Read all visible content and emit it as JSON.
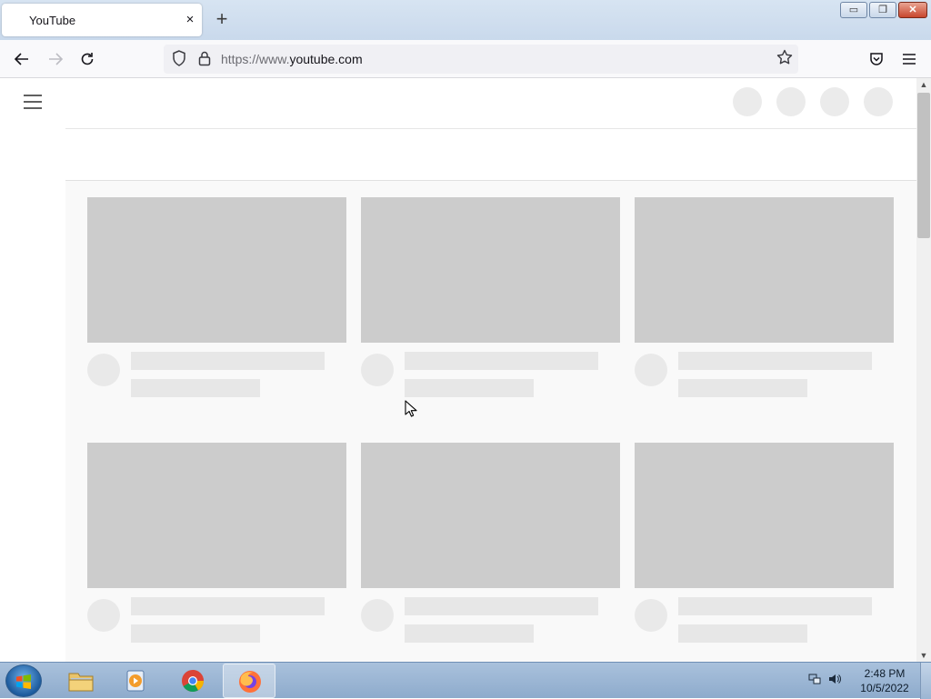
{
  "browser": {
    "tab_title": "YouTube",
    "tab_close": "×",
    "new_tab": "+",
    "url_prefix": "https://www.",
    "url_domain": "youtube.com",
    "window_controls": {
      "minimize": "▭",
      "restore": "❐",
      "close": "✕"
    }
  },
  "taskbar": {
    "apps": [
      "file-explorer",
      "media-player",
      "chrome",
      "firefox"
    ],
    "active_app": "firefox",
    "time": "2:48 PM",
    "date": "10/5/2022"
  },
  "page": {
    "loading_placeholders": true,
    "card_rows": 2,
    "card_columns": 3
  },
  "colors": {
    "placeholder_thumb": "#cccccc",
    "placeholder_text": "#e7e7e7",
    "content_bg": "#f9f9f9"
  }
}
